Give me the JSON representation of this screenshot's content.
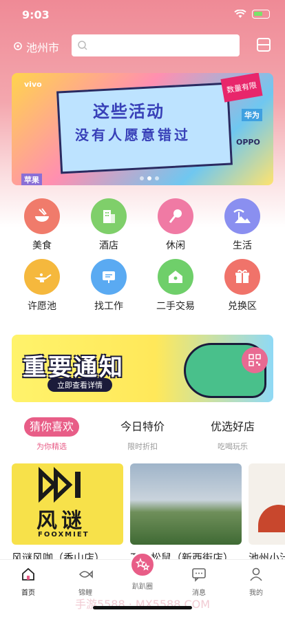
{
  "status_bar": {
    "time": "9:03"
  },
  "header": {
    "city": "池州市",
    "search_placeholder": ""
  },
  "banner": {
    "line1": "这些活动",
    "line2": "没有人愿意错过",
    "stamp": "数量有限",
    "brands": [
      "vivo",
      "华为",
      "苹果",
      "OPPO"
    ]
  },
  "categories": [
    {
      "label": "美食",
      "icon": "food-bowl-icon",
      "color": "#f07b6b"
    },
    {
      "label": "酒店",
      "icon": "hotel-building-icon",
      "color": "#7fcf6a"
    },
    {
      "label": "休闲",
      "icon": "microphone-icon",
      "color": "#f07aa4"
    },
    {
      "label": "生活",
      "icon": "palm-tree-icon",
      "color": "#8a8ff0"
    },
    {
      "label": "许愿池",
      "icon": "magic-lamp-icon",
      "color": "#f5b83d"
    },
    {
      "label": "找工作",
      "icon": "job-board-icon",
      "color": "#5aaaf2"
    },
    {
      "label": "二手交易",
      "icon": "house-icon",
      "color": "#6fcf6a"
    },
    {
      "label": "兑换区",
      "icon": "gift-icon",
      "color": "#f0736a"
    }
  ],
  "notice": {
    "title": "重要通知",
    "subtitle": "立即查看详情"
  },
  "tabs": [
    {
      "title": "猜你喜欢",
      "sub": "为你精选",
      "active": true
    },
    {
      "title": "今日特价",
      "sub": "限时折扣",
      "active": false
    },
    {
      "title": "优选好店",
      "sub": "吃喝玩乐",
      "active": false
    }
  ],
  "shops": [
    {
      "name": "风谜风咖（香山店）",
      "logo": "风谜",
      "logo_sub": "FOOXMIET"
    },
    {
      "name": "万口松鼠（新西街店）"
    },
    {
      "name": "池州小汁"
    }
  ],
  "tabbar": [
    {
      "label": "首页",
      "icon": "home-icon",
      "active": true
    },
    {
      "label": "锦鲤",
      "icon": "koi-fish-icon",
      "active": false
    },
    {
      "label": "趴趴圈",
      "icon": "stars-icon",
      "active": false
    },
    {
      "label": "消息",
      "icon": "message-icon",
      "active": false
    },
    {
      "label": "我的",
      "icon": "profile-icon",
      "active": false
    }
  ],
  "watermark": "手游5588 · MX5588.COM"
}
